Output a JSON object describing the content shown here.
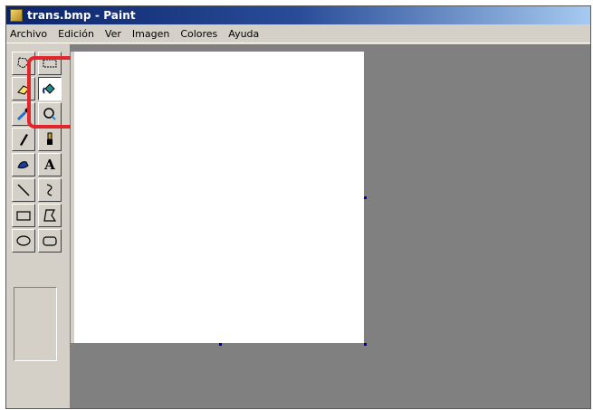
{
  "window": {
    "title": "trans.bmp - Paint"
  },
  "menu": {
    "items": [
      "Archivo",
      "Edición",
      "Ver",
      "Imagen",
      "Colores",
      "Ayuda"
    ]
  },
  "toolbox": {
    "tools": [
      {
        "name": "free-form-select-icon",
        "selected": false
      },
      {
        "name": "rectangle-select-icon",
        "selected": false
      },
      {
        "name": "eraser-icon",
        "selected": false
      },
      {
        "name": "fill-bucket-icon",
        "selected": true
      },
      {
        "name": "color-picker-icon",
        "selected": false
      },
      {
        "name": "magnifier-icon",
        "selected": false
      },
      {
        "name": "pencil-icon",
        "selected": false
      },
      {
        "name": "brush-icon",
        "selected": false
      },
      {
        "name": "airbrush-icon",
        "selected": false
      },
      {
        "name": "text-tool-icon",
        "selected": false,
        "glyph": "A"
      },
      {
        "name": "line-icon",
        "selected": false
      },
      {
        "name": "curve-icon",
        "selected": false
      },
      {
        "name": "rectangle-icon",
        "selected": false
      },
      {
        "name": "polygon-icon",
        "selected": false
      },
      {
        "name": "ellipse-icon",
        "selected": false
      },
      {
        "name": "rounded-rectangle-icon",
        "selected": false
      }
    ],
    "highlight_color": "#e0252b"
  },
  "colors": {
    "title_bar": "#0a246a",
    "workspace": "#808080",
    "canvas": "#ffffff",
    "face": "#d4d0c8"
  }
}
